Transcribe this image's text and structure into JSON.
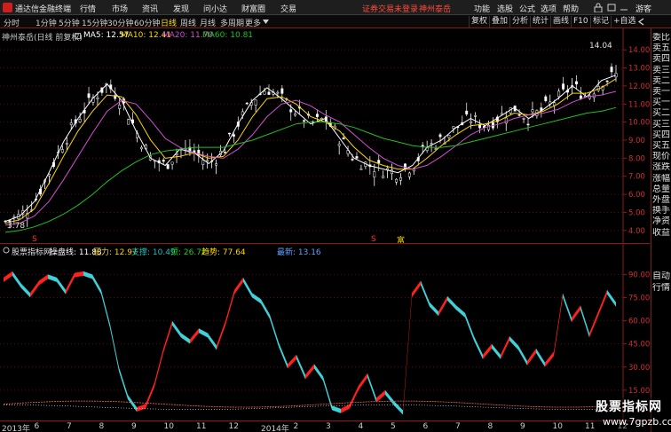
{
  "title_bar": {
    "app_name": "通达信金融终端",
    "menus": [
      "行情",
      "市场",
      "资讯",
      "发现",
      "问小达",
      "财富圈",
      "交易"
    ],
    "notice": "证券交易未登录",
    "stock_link": "神州泰岳",
    "right_menus": [
      "功能",
      "选股",
      "公式",
      "选项",
      "帮助"
    ],
    "user": "游客",
    "colors": {
      "brand": "#d21d1d",
      "notice": "#ff4a3a"
    }
  },
  "toolbar": {
    "periods": [
      "分时",
      "1分钟",
      "5分钟",
      "15分钟",
      "30分钟",
      "60分钟",
      "日线",
      "周线",
      "月线",
      "多周期",
      "更多"
    ],
    "active_period": "日线",
    "buttons": [
      "复权",
      "叠加",
      "分析",
      "统计",
      "画线",
      "F10",
      "标记",
      "+自选"
    ],
    "back_icon": "back-arrow-icon"
  },
  "main_chart": {
    "stock_title": "神州泰岳(日线 前复权)",
    "ma_items": [
      {
        "label": "MA5: 12.57",
        "color": "#ffffff"
      },
      {
        "label": "MA10: 12.41",
        "color": "#ffd700"
      },
      {
        "label": "MA20: 11.70",
        "color": "#d050d0"
      },
      {
        "label": "MA60: 10.81",
        "color": "#20c020"
      }
    ],
    "high_label": "14.04",
    "low_label": "3.78",
    "y_ticks": [
      "14.00",
      "13.00",
      "12.00",
      "11.00",
      "10.00",
      "9.00",
      "8.00",
      "7.00",
      "6.00",
      "5.00",
      "4.00"
    ],
    "markers": [
      "S",
      "S",
      "富"
    ]
  },
  "indicator": {
    "name": "股票指标网",
    "items": [
      {
        "label": "操盘线: 11.88",
        "color": "#ffffff"
      },
      {
        "label": "压力: 12.97",
        "color": "#ffd700"
      },
      {
        "label": "支撑: 10.49",
        "color": "#20c0c0"
      },
      {
        "label": "顶: 26.72",
        "color": "#20d020"
      },
      {
        "label": "趋势: 77.64",
        "color": "#ffd700"
      },
      {
        "label": "最新: 13.16",
        "color": "#5aa0ff"
      }
    ],
    "y_ticks": [
      "90.00",
      "75.00",
      "60.00",
      "45.00",
      "30.00",
      "15.00"
    ]
  },
  "chart_data": {
    "type": "line",
    "title": "神州泰岳(日线 前复权)",
    "x_labels": [
      "2013年",
      "6",
      "7",
      "8",
      "9",
      "10",
      "11",
      "12",
      "2014年",
      "2",
      "3",
      "4",
      "5",
      "6",
      "7",
      "8",
      "9",
      "10",
      "11",
      "12"
    ],
    "price": {
      "ylim": [
        3.5,
        14.5
      ],
      "series": [
        {
          "name": "MA5",
          "values": [
            4.5,
            4.8,
            5.6,
            7.2,
            8.9,
            10.2,
            11.3,
            12.1,
            11.2,
            9.5,
            8.0,
            7.6,
            8.5,
            8.3,
            7.7,
            8.4,
            9.9,
            11.2,
            11.9,
            11.3,
            10.6,
            9.9,
            10.2,
            9.1,
            8.0,
            7.6,
            7.4,
            7.2,
            7.6,
            8.6,
            9.0,
            9.7,
            10.2,
            9.8,
            10.3,
            10.8,
            10.2,
            10.7,
            11.3,
            12.0,
            11.4,
            12.3,
            12.6
          ]
        },
        {
          "name": "MA10",
          "values": [
            4.4,
            4.6,
            5.2,
            6.6,
            8.1,
            9.5,
            10.6,
            11.5,
            11.4,
            10.4,
            9.0,
            8.0,
            8.1,
            8.3,
            8.0,
            8.1,
            9.0,
            10.3,
            11.3,
            11.4,
            11.0,
            10.3,
            10.0,
            9.5,
            8.6,
            7.9,
            7.6,
            7.4,
            7.4,
            8.0,
            8.7,
            9.3,
            9.8,
            9.9,
            10.1,
            10.5,
            10.4,
            10.6,
            11.0,
            11.6,
            11.6,
            11.9,
            12.4
          ]
        },
        {
          "name": "MA20",
          "values": [
            4.3,
            4.4,
            4.8,
            5.6,
            6.8,
            8.1,
            9.4,
            10.6,
            11.2,
            11.0,
            10.1,
            9.1,
            8.6,
            8.3,
            8.1,
            8.0,
            8.5,
            9.3,
            10.3,
            11.0,
            11.2,
            10.9,
            10.4,
            10.0,
            9.3,
            8.6,
            8.0,
            7.6,
            7.4,
            7.6,
            8.1,
            8.7,
            9.3,
            9.7,
            9.9,
            10.2,
            10.4,
            10.5,
            10.7,
            11.1,
            11.4,
            11.5,
            11.7
          ]
        },
        {
          "name": "MA60",
          "values": [
            3.9,
            4.0,
            4.2,
            4.5,
            4.9,
            5.4,
            6.0,
            6.7,
            7.3,
            7.8,
            8.2,
            8.4,
            8.5,
            8.6,
            8.6,
            8.6,
            8.8,
            9.0,
            9.3,
            9.6,
            9.9,
            10.0,
            10.0,
            9.9,
            9.7,
            9.4,
            9.1,
            8.9,
            8.7,
            8.6,
            8.6,
            8.7,
            8.9,
            9.1,
            9.3,
            9.5,
            9.7,
            9.9,
            10.1,
            10.3,
            10.5,
            10.6,
            10.8
          ]
        }
      ]
    },
    "indicator": {
      "ylim": [
        0,
        100
      ],
      "series": [
        {
          "name": "操盘线",
          "values": [
            88,
            92,
            84,
            78,
            86,
            90,
            88,
            80,
            91,
            92,
            90,
            80,
            58,
            30,
            12,
            4,
            6,
            20,
            42,
            60,
            52,
            48,
            55,
            52,
            44,
            60,
            80,
            88,
            78,
            74,
            64,
            46,
            32,
            38,
            25,
            32,
            24,
            5,
            3,
            6,
            18,
            26,
            10,
            15,
            8,
            2,
            78,
            86,
            72,
            66,
            76,
            70,
            65,
            50,
            38,
            45,
            38,
            50,
            44,
            34,
            42,
            33,
            40,
            78,
            62,
            70,
            52,
            66,
            80,
            72
          ]
        }
      ]
    }
  },
  "side_panel": {
    "top_items": [
      "委比",
      "卖五",
      "卖四",
      "卖三",
      "卖二",
      "卖一",
      "买一",
      "买二",
      "买三",
      "买四",
      "买五",
      "现价",
      "涨跌",
      "涨幅",
      "总量",
      "外盘",
      "换手",
      "净资",
      "收益"
    ],
    "bottom_items": [
      "自动",
      "行情"
    ]
  },
  "watermark": {
    "line1": "股票指标网",
    "line2": "www.7gpzb.com"
  }
}
